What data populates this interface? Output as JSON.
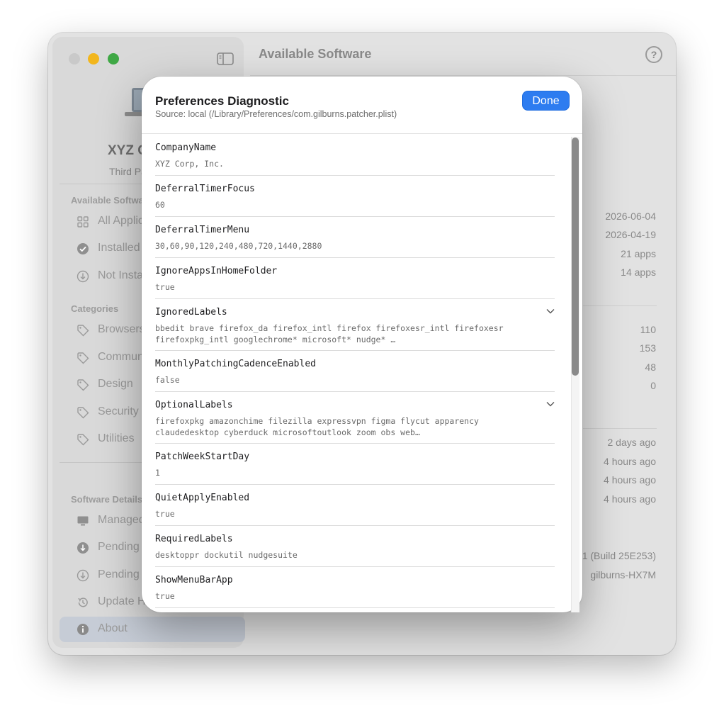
{
  "window": {
    "title": "Available Software",
    "help_label": "?"
  },
  "sidebar": {
    "org_name": "XYZ C",
    "org_subtitle": "Third Pa",
    "sections": [
      {
        "header": "Available Softwa",
        "items": [
          {
            "label": "All Applic",
            "icon": "grid-icon"
          },
          {
            "label": "Installed",
            "icon": "checkmark-circle-icon"
          },
          {
            "label": "Not Insta",
            "icon": "download-circle-icon"
          }
        ]
      },
      {
        "header": "Categories",
        "items": [
          {
            "label": "Browsers",
            "icon": "tag-icon"
          },
          {
            "label": "Communi",
            "icon": "tag-icon"
          },
          {
            "label": "Design",
            "icon": "tag-icon"
          },
          {
            "label": "Security",
            "icon": "tag-icon"
          },
          {
            "label": "Utilities",
            "icon": "tag-icon"
          }
        ]
      },
      {
        "header": "Software Details",
        "items": [
          {
            "label": "Managed",
            "icon": "display-icon"
          },
          {
            "label": "Pending U",
            "icon": "download-circle-filled-icon"
          },
          {
            "label": "Pending D",
            "icon": "download-circle-icon"
          },
          {
            "label": "Update H",
            "icon": "history-icon"
          },
          {
            "label": "About",
            "icon": "info-circle-icon",
            "selected": true
          }
        ]
      }
    ]
  },
  "main": {
    "values": [
      "2026-06-04",
      "2026-04-19",
      "21 apps",
      "14 apps",
      "110",
      "153",
      "48",
      "0",
      "2 days ago",
      "4 hours ago",
      "4 hours ago",
      "4 hours ago",
      "1 (Build 25E253)",
      "gilburns-HX7M"
    ]
  },
  "modal": {
    "title": "Preferences Diagnostic",
    "source": "Source: local (/Library/Preferences/com.gilburns.patcher.plist)",
    "done_label": "Done",
    "rows": [
      {
        "key": "CompanyName",
        "value": "XYZ Corp, Inc."
      },
      {
        "key": "DeferralTimerFocus",
        "value": "60"
      },
      {
        "key": "DeferralTimerMenu",
        "value": "30,60,90,120,240,480,720,1440,2880"
      },
      {
        "key": "IgnoreAppsInHomeFolder",
        "value": "true"
      },
      {
        "key": "IgnoredLabels",
        "value": "bbedit brave firefox_da firefox_intl firefox firefoxesr_intl firefoxesr firefoxpkg_intl googlechrome* microsoft* nudge* …",
        "expandable": true
      },
      {
        "key": "MonthlyPatchingCadenceEnabled",
        "value": "false"
      },
      {
        "key": "OptionalLabels",
        "value": "firefoxpkg amazonchime filezilla expressvpn figma flycut apparency claudedesktop cyberduck microsoftoutlook zoom obs web…",
        "expandable": true
      },
      {
        "key": "PatchWeekStartDay",
        "value": "1"
      },
      {
        "key": "QuietApplyEnabled",
        "value": "true"
      },
      {
        "key": "RequiredLabels",
        "value": "desktoppr dockutil nudgesuite"
      },
      {
        "key": "ShowMenuBarApp",
        "value": "true"
      }
    ]
  },
  "colors": {
    "accent": "#2d7cf0",
    "close": "#c9c9c9",
    "minimize": "#f2b61d",
    "maximize": "#3fa845"
  }
}
